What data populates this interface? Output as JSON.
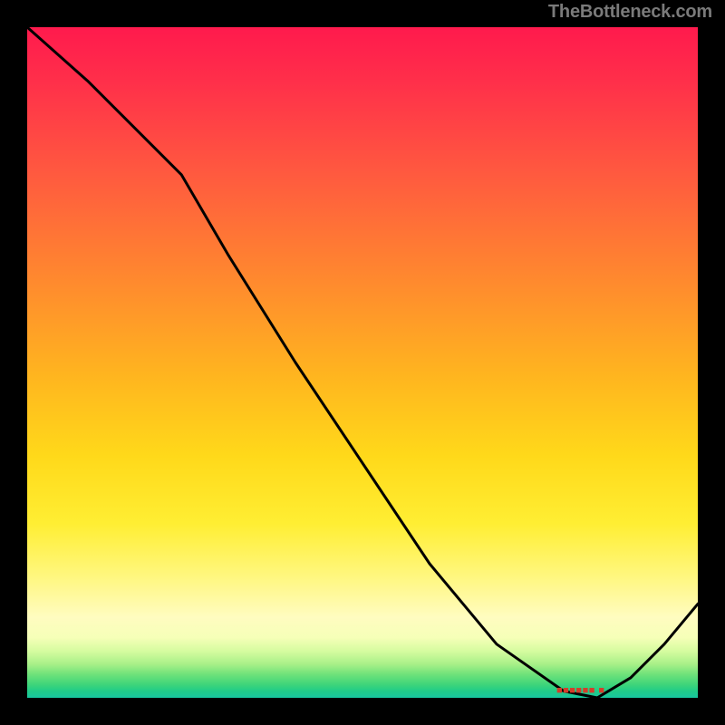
{
  "watermark": "TheBottleneck.com",
  "marker_label": "■■■■■■ ■",
  "chart_data": {
    "type": "line",
    "title": "",
    "xlabel": "",
    "ylabel": "",
    "xlim": [
      0,
      100
    ],
    "ylim": [
      0,
      100
    ],
    "series": [
      {
        "name": "curve",
        "x": [
          0,
          9,
          18,
          23,
          30,
          40,
          50,
          60,
          70,
          80,
          85,
          90,
          95,
          100
        ],
        "values": [
          100,
          92,
          83,
          78,
          66,
          50,
          35,
          20,
          8,
          1,
          0,
          3,
          8,
          14
        ]
      }
    ],
    "marker": {
      "x": 85,
      "y": 0
    },
    "gradient_stops": [
      {
        "pos": 0.0,
        "color": "#ff1a4d"
      },
      {
        "pos": 0.4,
        "color": "#ff8a2e"
      },
      {
        "pos": 0.72,
        "color": "#ffee33"
      },
      {
        "pos": 0.9,
        "color": "#fffcc0"
      },
      {
        "pos": 1.0,
        "color": "#18c7a0"
      }
    ]
  }
}
